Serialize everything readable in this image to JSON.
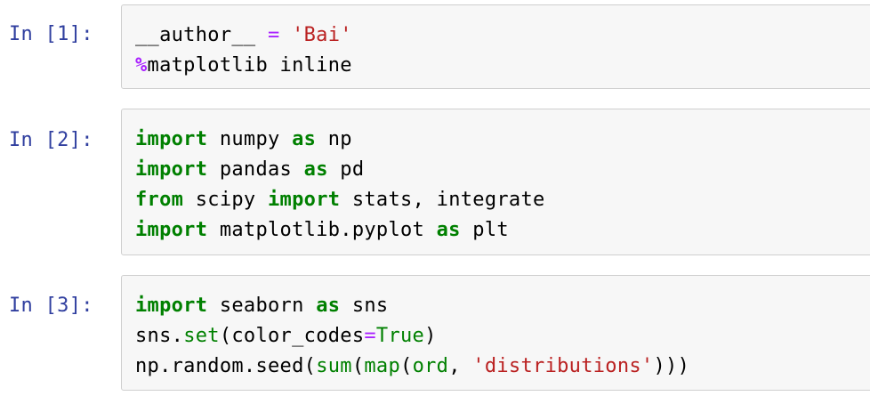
{
  "cells": [
    {
      "prompt": "In [1]:",
      "lines": [
        [
          {
            "t": "plain",
            "v": "__author__ "
          },
          {
            "t": "op",
            "v": "="
          },
          {
            "t": "plain",
            "v": " "
          },
          {
            "t": "str",
            "v": "'Bai'"
          }
        ],
        [
          {
            "t": "magic",
            "v": "%"
          },
          {
            "t": "plain",
            "v": "matplotlib inline"
          }
        ]
      ]
    },
    {
      "prompt": "In [2]:",
      "lines": [
        [
          {
            "t": "kw",
            "v": "import"
          },
          {
            "t": "plain",
            "v": " numpy "
          },
          {
            "t": "kw",
            "v": "as"
          },
          {
            "t": "plain",
            "v": " np"
          }
        ],
        [
          {
            "t": "kw",
            "v": "import"
          },
          {
            "t": "plain",
            "v": " pandas "
          },
          {
            "t": "kw",
            "v": "as"
          },
          {
            "t": "plain",
            "v": " pd"
          }
        ],
        [
          {
            "t": "kw",
            "v": "from"
          },
          {
            "t": "plain",
            "v": " scipy "
          },
          {
            "t": "kw",
            "v": "import"
          },
          {
            "t": "plain",
            "v": " stats, integrate"
          }
        ],
        [
          {
            "t": "kw",
            "v": "import"
          },
          {
            "t": "plain",
            "v": " matplotlib.pyplot "
          },
          {
            "t": "kw",
            "v": "as"
          },
          {
            "t": "plain",
            "v": " plt"
          }
        ]
      ]
    },
    {
      "prompt": "In [3]:",
      "lines": [
        [
          {
            "t": "kw",
            "v": "import"
          },
          {
            "t": "plain",
            "v": " seaborn "
          },
          {
            "t": "kw",
            "v": "as"
          },
          {
            "t": "plain",
            "v": " sns"
          }
        ],
        [
          {
            "t": "plain",
            "v": "sns."
          },
          {
            "t": "builtin",
            "v": "set"
          },
          {
            "t": "plain",
            "v": "(color_codes"
          },
          {
            "t": "op",
            "v": "="
          },
          {
            "t": "builtin",
            "v": "True"
          },
          {
            "t": "plain",
            "v": ")"
          }
        ],
        [
          {
            "t": "plain",
            "v": "np.random.seed("
          },
          {
            "t": "builtin",
            "v": "sum"
          },
          {
            "t": "plain",
            "v": "("
          },
          {
            "t": "builtin",
            "v": "map"
          },
          {
            "t": "plain",
            "v": "("
          },
          {
            "t": "builtin",
            "v": "ord"
          },
          {
            "t": "plain",
            "v": ", "
          },
          {
            "t": "str",
            "v": "'distributions'"
          },
          {
            "t": "plain",
            "v": ")))"
          }
        ]
      ]
    }
  ],
  "colors": {
    "prompt": "#303f9f",
    "keyword": "#008000",
    "string": "#ba2121",
    "magic": "#aa22ff",
    "cell_background": "#f7f7f7",
    "cell_border": "#cfcfcf"
  }
}
